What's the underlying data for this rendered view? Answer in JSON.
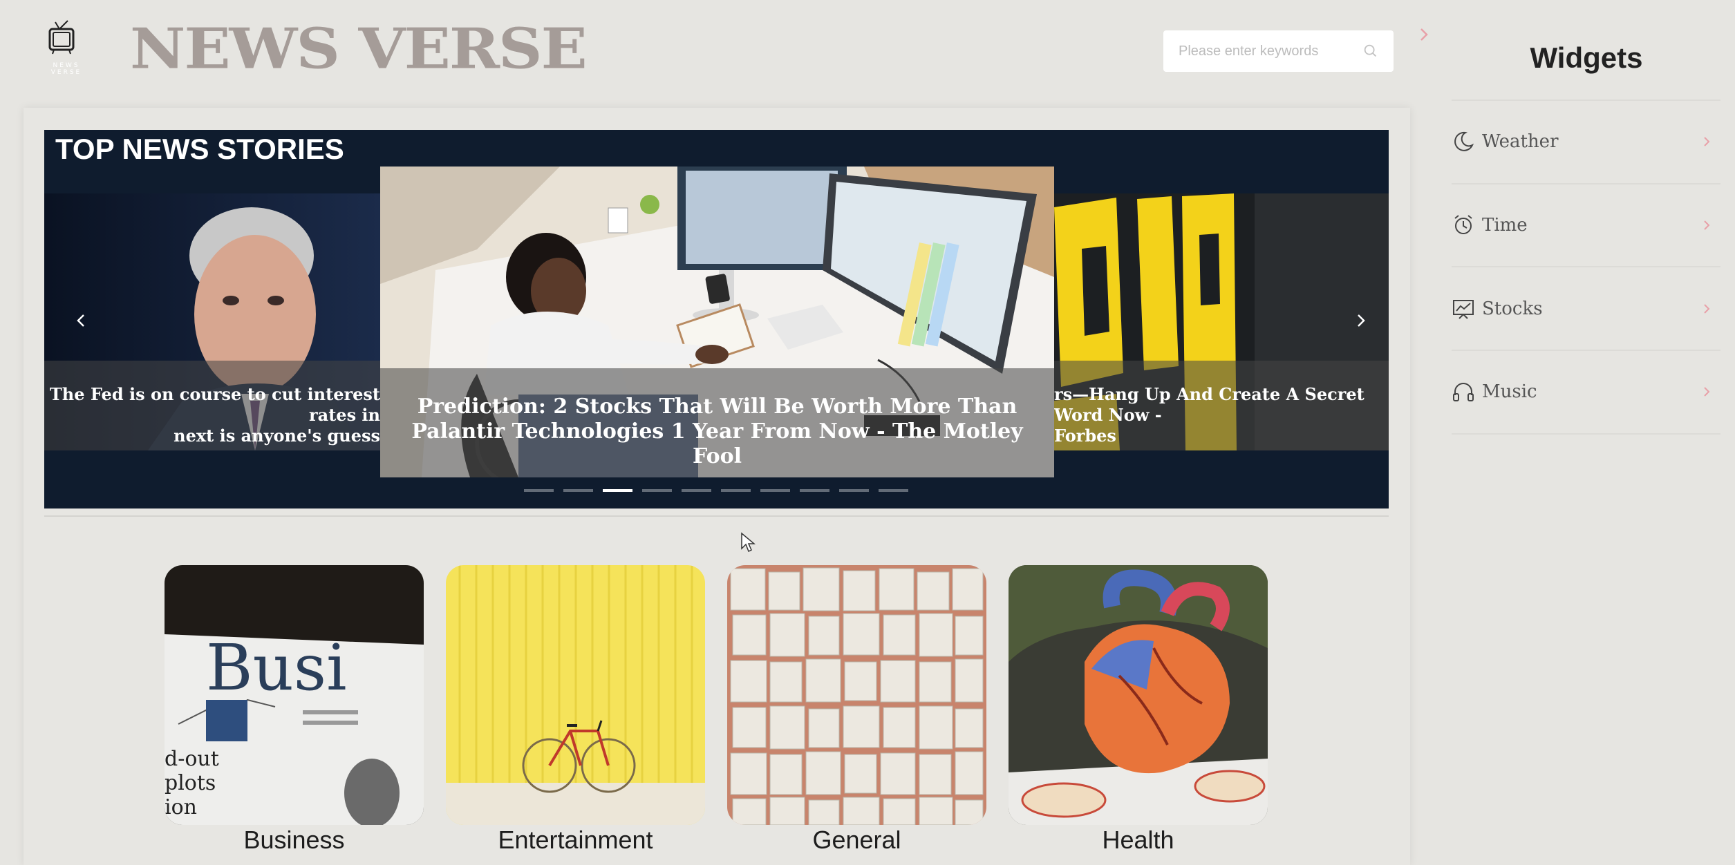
{
  "header": {
    "brand": "NEWS VERSE",
    "logo_text": "NEWS VERSE",
    "search_placeholder": "Please enter keywords"
  },
  "carousel": {
    "title": "TOP NEWS STORIES",
    "slides": [
      {
        "caption": "The Fed is on course to cut interest rates in\nnext is anyone's guess"
      },
      {
        "caption": "Prediction: 2 Stocks That Will Be Worth More Than Palantir Technologies 1 Year From Now - The Motley Fool"
      },
      {
        "caption": "rs—Hang Up And Create A Secret Word Now -\nForbes"
      }
    ],
    "indicator_count": 10,
    "active_index": 2
  },
  "categories": [
    {
      "label": "Business"
    },
    {
      "label": "Entertainment"
    },
    {
      "label": "General"
    },
    {
      "label": "Health"
    }
  ],
  "widgets": {
    "title": "Widgets",
    "items": [
      {
        "label": "Weather",
        "icon": "moon-icon"
      },
      {
        "label": "Time",
        "icon": "alarm-clock-icon"
      },
      {
        "label": "Stocks",
        "icon": "stock-chart-icon"
      },
      {
        "label": "Music",
        "icon": "headphones-icon"
      }
    ]
  },
  "colors": {
    "background": "#e6e5e1",
    "brand": "#a59c98",
    "carousel_bg": "#0f1c2e",
    "accent_arrow": "#e8a0a8"
  }
}
